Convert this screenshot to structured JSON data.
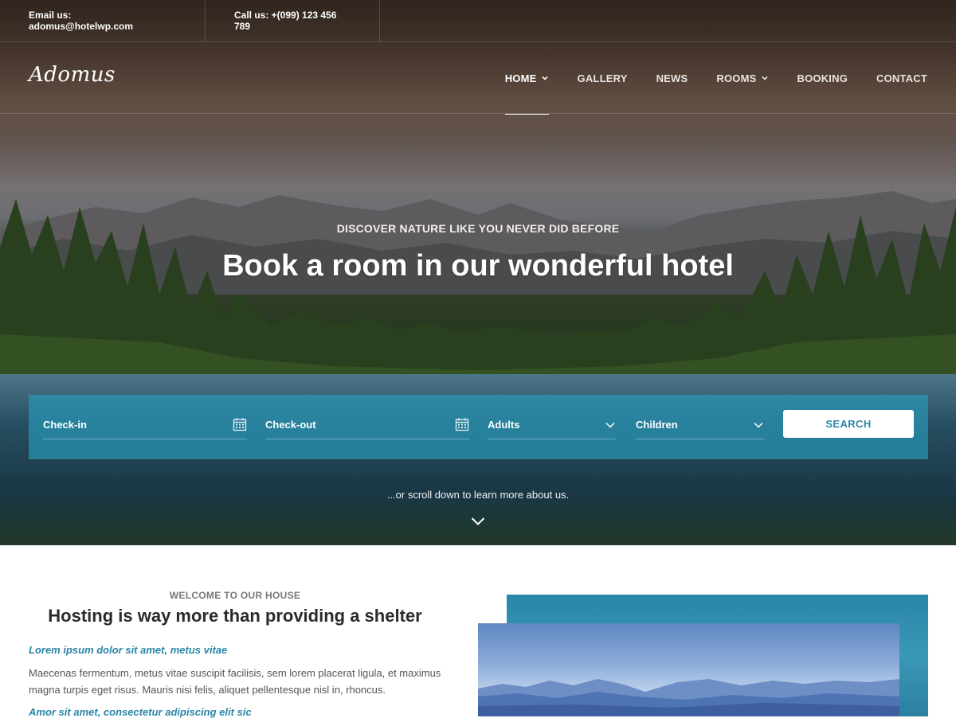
{
  "topbar": {
    "email": "Email us: adomus@hotelwp.com",
    "phone": "Call us: +(099) 123 456 789"
  },
  "brand": {
    "logo": "Adomus"
  },
  "nav": {
    "items": [
      {
        "label": "HOME",
        "has_dropdown": true,
        "active": true
      },
      {
        "label": "GALLERY",
        "has_dropdown": false,
        "active": false
      },
      {
        "label": "NEWS",
        "has_dropdown": false,
        "active": false
      },
      {
        "label": "ROOMS",
        "has_dropdown": true,
        "active": false
      },
      {
        "label": "BOOKING",
        "has_dropdown": false,
        "active": false
      },
      {
        "label": "CONTACT",
        "has_dropdown": false,
        "active": false
      }
    ]
  },
  "hero": {
    "tagline": "DISCOVER NATURE LIKE YOU NEVER DID BEFORE",
    "headline": "Book a room in our wonderful hotel",
    "scroll_text": "...or scroll down to learn more about us."
  },
  "booking": {
    "checkin_placeholder": "Check-in",
    "checkout_placeholder": "Check-out",
    "adults_placeholder": "Adults",
    "children_placeholder": "Children",
    "search_label": "SEARCH"
  },
  "welcome": {
    "kicker": "WELCOME TO OUR HOUSE",
    "title": "Hosting is way more than providing a shelter",
    "subtitle1": "Lorem ipsum dolor sit amet, metus vitae",
    "paragraph": "Maecenas fermentum, metus vitae suscipit facilisis, sem lorem placerat ligula, et maximus magna turpis eget risus. Mauris nisi felis, aliquet pellentesque nisl in, rhoncus.",
    "subtitle2": "Amor sit amet, consectetur adipiscing elit sic"
  },
  "colors": {
    "accent": "#2a86a8",
    "booking_bar": "#2896b4",
    "text_dark": "#2b2b2b"
  },
  "icons": {
    "calendar": "calendar-icon",
    "chevron": "chevron-down-icon"
  }
}
